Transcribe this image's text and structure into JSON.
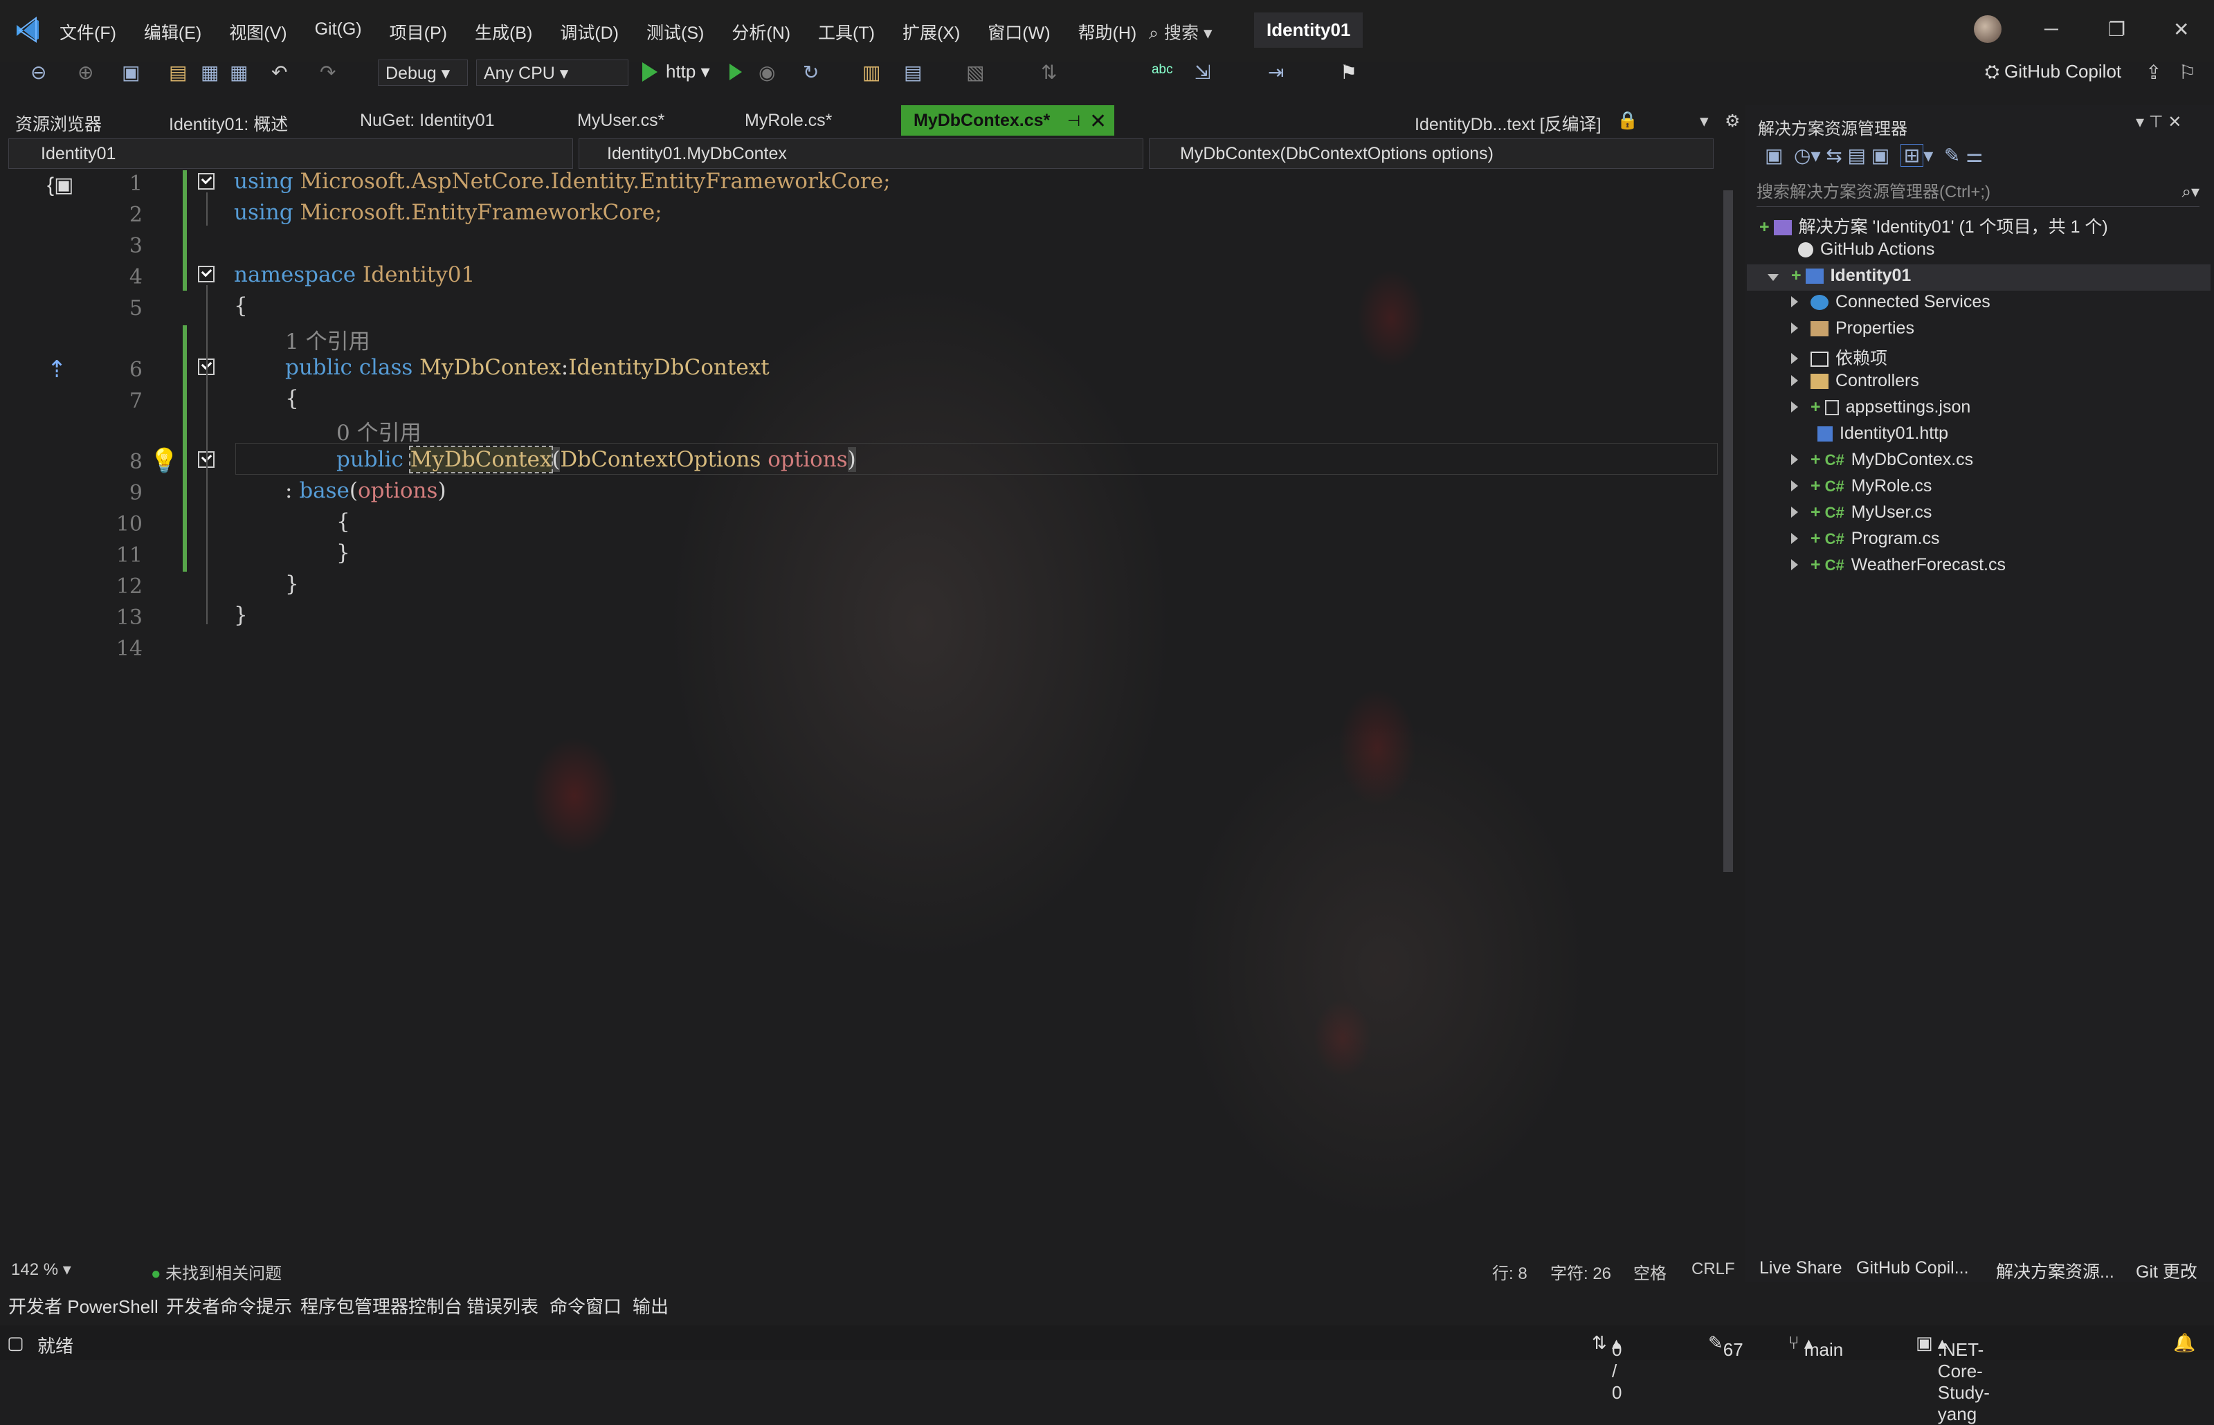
{
  "menubar": {
    "items": [
      "文件(F)",
      "编辑(E)",
      "视图(V)",
      "Git(G)",
      "项目(P)",
      "生成(B)",
      "调试(D)",
      "测试(S)",
      "分析(N)",
      "工具(T)",
      "扩展(X)",
      "窗口(W)",
      "帮助(H)"
    ],
    "search": "搜索",
    "solution_name": "Identity01"
  },
  "toolbar": {
    "config": "Debug",
    "platform": "Any CPU",
    "run_target": "http",
    "copilot": "GitHub Copilot"
  },
  "tabs": {
    "solution_explorer_tab": "资源浏览器",
    "items": [
      "Identity01: 概述",
      "NuGet: Identity01",
      "MyUser.cs*",
      "MyRole.cs*",
      "MyDbContex.cs*",
      "IdentityDb...text [反编译]"
    ],
    "active_index": 4
  },
  "navbar": {
    "project": "Identity01",
    "class": "Identity01.MyDbContex",
    "member": "MyDbContex(DbContextOptions options)"
  },
  "editor": {
    "line_numbers": [
      "1",
      "2",
      "3",
      "4",
      "5",
      "6",
      "7",
      "8",
      "9",
      "10",
      "11",
      "12",
      "13",
      "14"
    ],
    "lines": {
      "l1_kw": "using",
      "l1_ns": "Microsoft.AspNetCore.Identity.EntityFrameworkCore;",
      "l2_kw": "using",
      "l2_ns": "Microsoft.EntityFrameworkCore;",
      "l4_kw": "namespace",
      "l4_ns": "Identity01",
      "l5": "{",
      "ref_class": "1 个引用",
      "l6_kw": "public class",
      "l6_name": "MyDbContex",
      "l6_sep": ":",
      "l6_base": "IdentityDbContext",
      "l7": "{",
      "ref_ctor": "0 个引用",
      "l8_kw": "public",
      "l8_name": "MyDbContex",
      "l8_open": "(",
      "l8_type": "DbContextOptions",
      "l8_param": "options",
      "l8_close": ")",
      "l9_colon": ":",
      "l9_base": "base",
      "l9_open": "(",
      "l9_param": "options",
      "l9_close": ")",
      "l10": "{",
      "l11": "}",
      "l12": "}",
      "l13": "}"
    }
  },
  "editor_status": {
    "zoom": "142 %",
    "issues": "未找到相关问题",
    "line": "行: 8",
    "col": "字符: 26",
    "spacing": "空格",
    "eol": "CRLF"
  },
  "tool_tabs": [
    "开发者 PowerShell",
    "开发者命令提示",
    "程序包管理器控制台",
    "错误列表",
    "命令窗口",
    "输出"
  ],
  "solution_explorer": {
    "title": "解决方案资源管理器",
    "search_placeholder": "搜索解决方案资源管理器(Ctrl+;)",
    "solution": "解决方案 'Identity01' (1 个项目，共 1 个)",
    "github_actions": "GitHub Actions",
    "project": "Identity01",
    "items": [
      "Connected Services",
      "Properties",
      "依赖项",
      "Controllers",
      "appsettings.json",
      "Identity01.http",
      "MyDbContex.cs",
      "MyRole.cs",
      "MyUser.cs",
      "Program.cs",
      "WeatherForecast.cs"
    ],
    "bottom_tabs": [
      "Live Share",
      "GitHub Copil...",
      "解决方案资源...",
      "Git 更改"
    ]
  },
  "statusbar": {
    "ready": "就绪",
    "sync": "0 / 0",
    "edits": "67",
    "branch": "main",
    "repo": ".NET-Core-Study-yang"
  },
  "colors": {
    "accent_green": "#3e9d31",
    "keyword": "#569cd6",
    "type": "#d7ba7d",
    "param": "#d27d7d"
  }
}
